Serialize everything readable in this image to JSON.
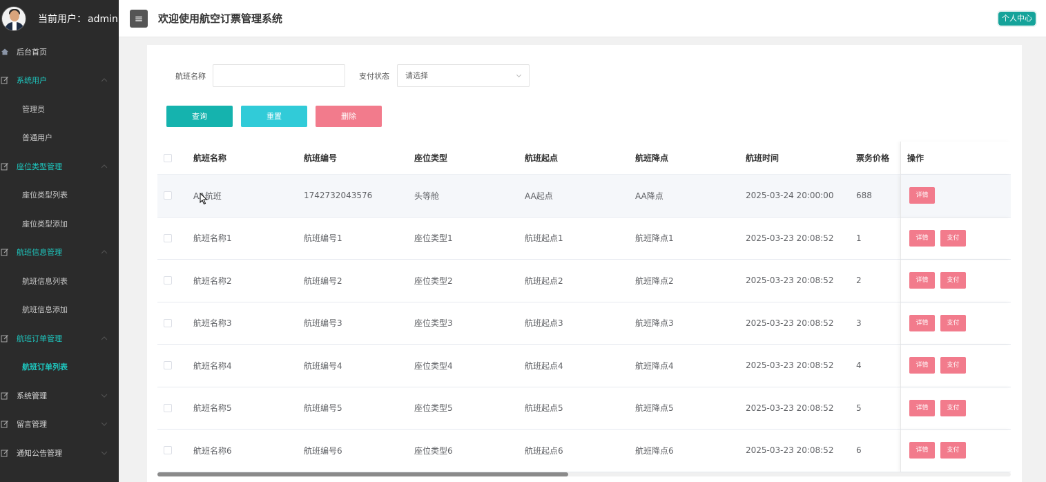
{
  "user": {
    "label": "当前用户：",
    "name": "admin"
  },
  "header": {
    "title": "欢迎使用航空订票管理系统",
    "profile_button": "个人中心",
    "menu_icon": "≡"
  },
  "sidebar": {
    "home": "后台首页",
    "groups": [
      {
        "label": "系统用户",
        "expanded": true,
        "items": [
          "管理员",
          "普通用户"
        ]
      },
      {
        "label": "座位类型管理",
        "expanded": true,
        "items": [
          "座位类型列表",
          "座位类型添加"
        ]
      },
      {
        "label": "航班信息管理",
        "expanded": true,
        "items": [
          "航班信息列表",
          "航班信息添加"
        ]
      },
      {
        "label": "航班订单管理",
        "expanded": true,
        "items": [
          "航班订单列表"
        ]
      },
      {
        "label": "系统管理",
        "expanded": false,
        "items": []
      },
      {
        "label": "留言管理",
        "expanded": false,
        "items": []
      },
      {
        "label": "通知公告管理",
        "expanded": false,
        "items": []
      }
    ],
    "active_item": "航班订单列表"
  },
  "search": {
    "flight_name_label": "航班名称",
    "flight_name_value": "",
    "pay_status_label": "支付状态",
    "pay_status_value": "请选择"
  },
  "buttons": {
    "query": "查询",
    "reset": "重置",
    "delete": "删除"
  },
  "table": {
    "headers": [
      "航班名称",
      "航班编号",
      "座位类型",
      "航班起点",
      "航班降点",
      "航班时间",
      "票务价格",
      "操作"
    ],
    "detail_label": "详情",
    "pay_label": "支付",
    "rows": [
      {
        "name": "AA航班",
        "code": "1742732043576",
        "seat": "头等舱",
        "from": "AA起点",
        "to": "AA降点",
        "time": "2025-03-24 20:00:00",
        "price": "688",
        "show_pay": false
      },
      {
        "name": "航班名称1",
        "code": "航班编号1",
        "seat": "座位类型1",
        "from": "航班起点1",
        "to": "航班降点1",
        "time": "2025-03-23 20:08:52",
        "price": "1",
        "show_pay": true
      },
      {
        "name": "航班名称2",
        "code": "航班编号2",
        "seat": "座位类型2",
        "from": "航班起点2",
        "to": "航班降点2",
        "time": "2025-03-23 20:08:52",
        "price": "2",
        "show_pay": true
      },
      {
        "name": "航班名称3",
        "code": "航班编号3",
        "seat": "座位类型3",
        "from": "航班起点3",
        "to": "航班降点3",
        "time": "2025-03-23 20:08:52",
        "price": "3",
        "show_pay": true
      },
      {
        "name": "航班名称4",
        "code": "航班编号4",
        "seat": "座位类型4",
        "from": "航班起点4",
        "to": "航班降点4",
        "time": "2025-03-23 20:08:52",
        "price": "4",
        "show_pay": true
      },
      {
        "name": "航班名称5",
        "code": "航班编号5",
        "seat": "座位类型5",
        "from": "航班起点5",
        "to": "航班降点5",
        "time": "2025-03-23 20:08:52",
        "price": "5",
        "show_pay": true
      },
      {
        "name": "航班名称6",
        "code": "航班编号6",
        "seat": "座位类型6",
        "from": "航班起点6",
        "to": "航班降点6",
        "time": "2025-03-23 20:08:52",
        "price": "6",
        "show_pay": true
      }
    ]
  },
  "colors": {
    "sidebar_bg": "#2b2b2b",
    "accent": "#1ec8c0",
    "danger": "#f27b8c",
    "query_btn": "#15b3ae",
    "reset_btn": "#31cbd8"
  }
}
